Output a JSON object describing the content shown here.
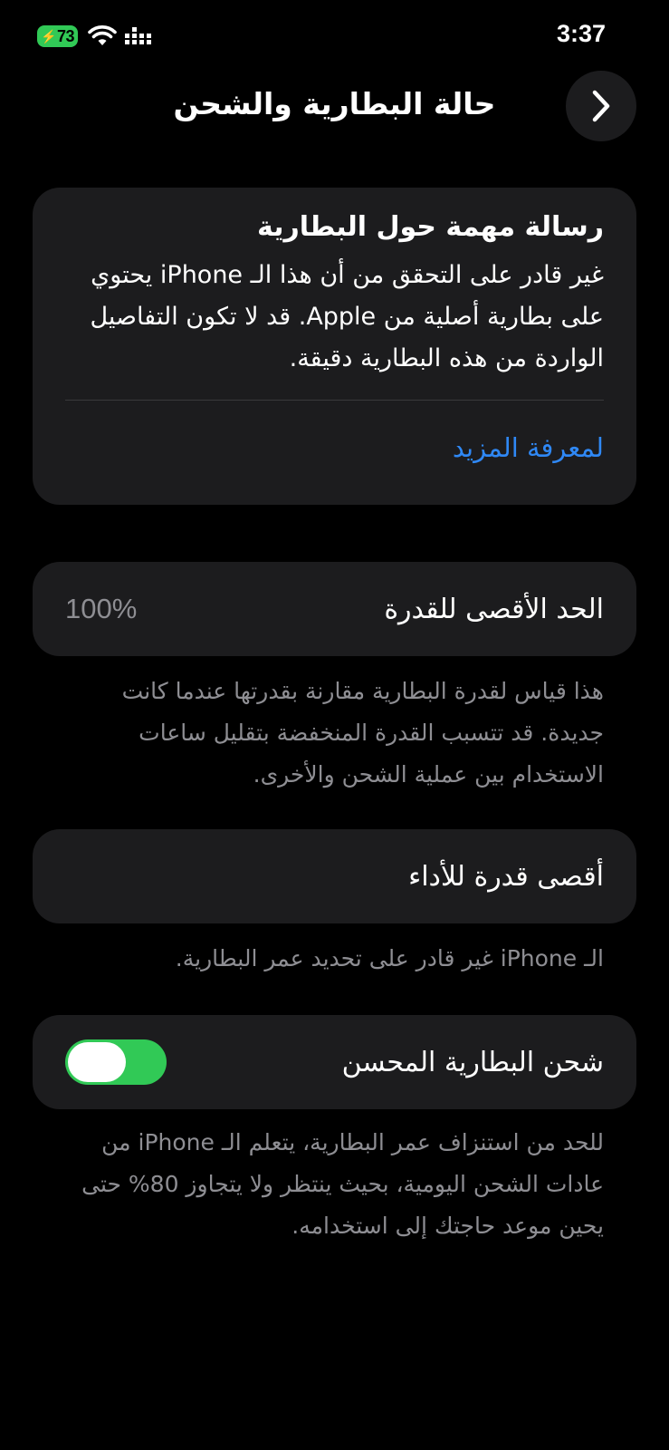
{
  "status_bar": {
    "battery_level": "73",
    "time": "3:37",
    "battery_color": "#31c956",
    "icons": [
      "bolt-icon",
      "wifi-icon",
      "signal-icon"
    ]
  },
  "nav": {
    "title": "حالة البطارية والشحن",
    "back_icon": "chevron-right-icon"
  },
  "message_card": {
    "title": "رسالة مهمة حول البطارية",
    "body": "غير قادر على التحقق من أن هذا الـ iPhone يحتوي على بطارية أصلية من Apple. قد لا تكون التفاصيل الواردة من هذه البطارية دقيقة.",
    "link": "لمعرفة المزيد",
    "link_color": "#2f88f5"
  },
  "maximum_capacity": {
    "label": "الحد الأقصى للقدرة",
    "value": "100%",
    "footnote": "هذا قياس لقدرة البطارية مقارنة بقدرتها عندما كانت جديدة. قد تتسبب القدرة المنخفضة بتقليل ساعات الاستخدام بين عملية الشحن والأخرى."
  },
  "peak_performance": {
    "label": "أقصى قدرة للأداء",
    "footnote": "الـ iPhone غير قادر على تحديد عمر البطارية."
  },
  "optimized_charging": {
    "label": "شحن البطارية المحسن",
    "enabled": true,
    "toggle_color": "#31c956",
    "footnote": "للحد من استنزاف عمر البطارية، يتعلم الـ iPhone من عادات الشحن اليومية، بحيث ينتظر ولا يتجاوز 80% حتى يحين موعد حاجتك إلى استخدامه."
  }
}
